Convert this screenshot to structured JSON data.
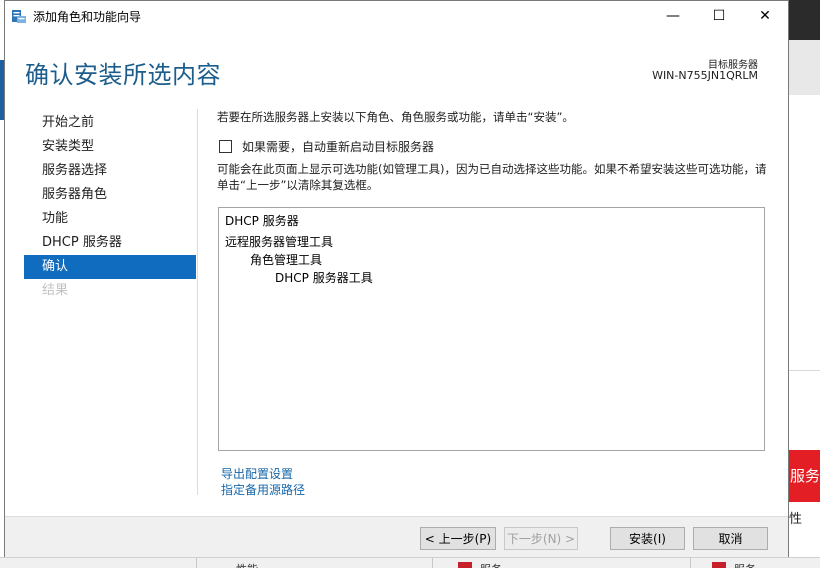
{
  "window": {
    "title": "添加角色和功能向导",
    "minimize": "—",
    "maximize": "☐",
    "close": "✕"
  },
  "header": {
    "title": "确认安装所选内容",
    "target_label": "目标服务器",
    "target_server": "WIN-N755JN1QRLM"
  },
  "nav": {
    "items": [
      {
        "label": "开始之前",
        "state": "normal"
      },
      {
        "label": "安装类型",
        "state": "normal"
      },
      {
        "label": "服务器选择",
        "state": "normal"
      },
      {
        "label": "服务器角色",
        "state": "normal"
      },
      {
        "label": "功能",
        "state": "normal"
      },
      {
        "label": "DHCP 服务器",
        "state": "normal"
      },
      {
        "label": "确认",
        "state": "active"
      },
      {
        "label": "结果",
        "state": "disabled"
      }
    ]
  },
  "content": {
    "intro": "若要在所选服务器上安装以下角色、角色服务或功能，请单击“安装”。",
    "restart_label": "如果需要，自动重新启动目标服务器",
    "restart_checked": false,
    "note": "可能会在此页面上显示可选功能(如管理工具)，因为已自动选择这些功能。如果不希望安装这些可选功能，请单击“上一步”以清除其复选框。",
    "items": [
      {
        "label": "DHCP 服务器",
        "level": 0
      },
      {
        "label": "远程服务器管理工具",
        "level": 0
      },
      {
        "label": "角色管理工具",
        "level": 1
      },
      {
        "label": "DHCP 服务器工具",
        "level": 2
      }
    ],
    "export_link": "导出配置设置",
    "source_link": "指定备用源路径"
  },
  "footer": {
    "prev": "< 上一步(P)",
    "next": "下一步(N) >",
    "install": "安装(I)",
    "cancel": "取消"
  },
  "background": {
    "red_text": "服务器",
    "side_text": "性",
    "bottom_left_text": "性能",
    "bottom_mid_text": "服务",
    "bottom_right_text": "服务"
  },
  "colors": {
    "title_blue": "#1c5d8c",
    "nav_active": "#0f6cbf",
    "link_blue": "#1566a8",
    "bg_red": "#e31e24"
  }
}
